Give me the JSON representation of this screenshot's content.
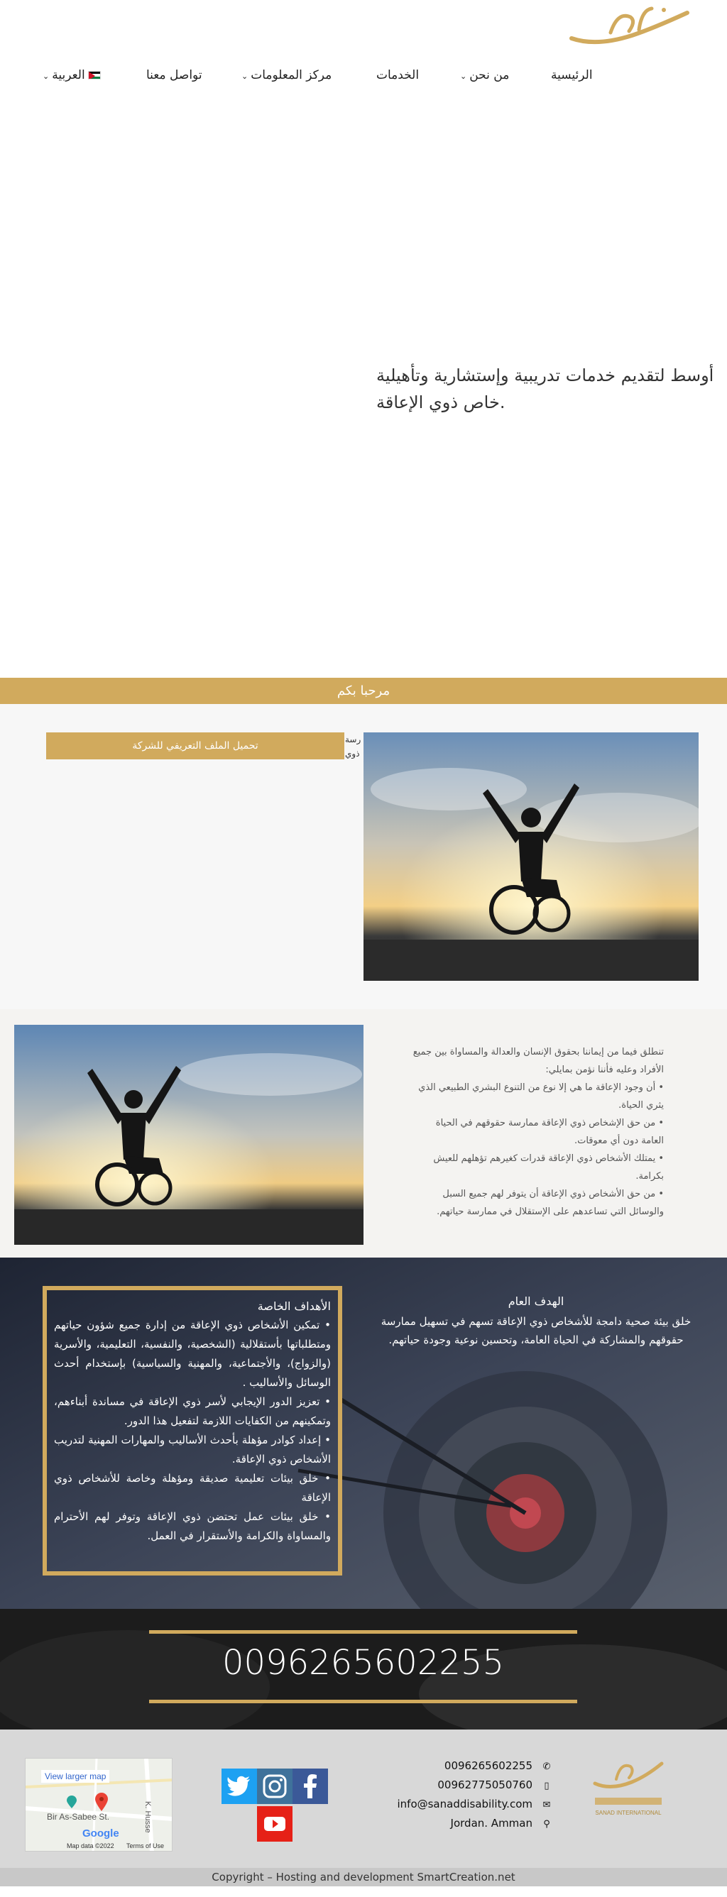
{
  "header": {
    "nav": [
      {
        "label": "الرئيسية",
        "dropdown": false
      },
      {
        "label": "من نحن",
        "dropdown": true
      },
      {
        "label": "الخدمات",
        "dropdown": false
      },
      {
        "label": "مركز المعلومات",
        "dropdown": true
      },
      {
        "label": "تواصل معنا",
        "dropdown": false
      },
      {
        "label": "العربية",
        "dropdown": true
      }
    ],
    "flash_icon": "⚡",
    "slider_prev": "‹",
    "slider_next": "›"
  },
  "hero": {
    "line1": "أوسط لتقديم خدمات تدريبية وإستشارية وتأهيلية",
    "line2": "خاص ذوي الإعاقة."
  },
  "welcome": {
    "bar_title": "مرحبا بكم",
    "download_label": "تحميل الملف التعريفي للشركة",
    "snippet_line1": "رسة",
    "snippet_line2": "ذوي"
  },
  "beliefs": {
    "intro": "تنطلق فيما من إيماننا بحقوق الإنسان والعدالة والمساواة بين جميع الأفراد وعليه فأننا نؤمن بمايلي:",
    "items": [
      "• أن وجود الإعاقة ما هي إلا نوع من التنوع البشري الطبيعي الذي يثري الحياة.",
      "• من حق الإشخاص ذوي الإعاقة ممارسة حقوقهم في الحياة العامة دون أي معوقات.",
      "• يمتلك الأشخاص ذوي الإعاقة قدرات كغيرهم تؤهلهم للعيش بكرامة.",
      "• من حق الأشخاص ذوي الإعاقة أن يتوفر لهم جميع السبل والوسائل التي تساعدهم على الإستقلال في ممارسة حياتهم."
    ]
  },
  "goals": {
    "general_title": "الهدف العام",
    "general_body": "خلق بيئة صحية دامجة للأشخاص ذوي الإعاقة تسهم في تسهيل ممارسة حقوقهم والمشاركة في الحياة العامة، وتحسين نوعية وجودة حياتهم.",
    "special_title": "الأهداف الخاصة",
    "special_items": [
      "• تمكين الأشخاص ذوي الإعاقة من إدارة جميع شؤون حياتهم ومتطلباتها بأستقلالية (الشخصية، والنفسية، التعليمية، والأسرية (والزواج)، والأجتماعية، والمهنية والسياسية) بإستخدام أحدث الوسائل والأساليب .",
      "• تعزيز الدور الإيجابي لأسر ذوي الإعاقة في مساندة أبناءهم، وتمكينهم من الكفايات اللازمة لتفعيل هذا الدور.",
      "• إعداد كوادر مؤهلة بأحدث الأساليب والمهارات المهنية لتدريب الأشخاص ذوي الإعاقة.",
      "• خلق بيئات تعليمية صديقة ومؤهلة وخاصة للأشخاص ذوي الإعاقة",
      "• خلق بيئات عمل تحتضن ذوي الإعاقة وتوفر لهم الأحترام والمساواة والكرامة والأستقرار في العمل."
    ]
  },
  "phone_band": {
    "number": "0096265602255"
  },
  "footer": {
    "contacts": [
      {
        "icon": "phone-icon",
        "glyph": "✆",
        "text": "0096265602255"
      },
      {
        "icon": "mobile-icon",
        "glyph": "▯",
        "text": "00962775050760"
      },
      {
        "icon": "envelope-icon",
        "glyph": "✉",
        "text": "info@sanaddisability.com"
      },
      {
        "icon": "map-marker-icon",
        "glyph": "⚲",
        "text": "Jordan. Amman"
      }
    ],
    "map": {
      "larger_link": "View larger map",
      "street": "Bir As-Sabee St.",
      "brand": "Google",
      "data": "Map data ©2022",
      "terms": "Terms of Use",
      "vertical": "K. Husse"
    },
    "logo_text": "SANAD INTERNATIONAL",
    "colors": {
      "gold": "#d1aa5d",
      "twitter": "#1da1f2",
      "facebook": "#3b5998",
      "youtube": "#e62117"
    }
  },
  "copyright": "Copyright – Hosting and development SmartCreation.net"
}
